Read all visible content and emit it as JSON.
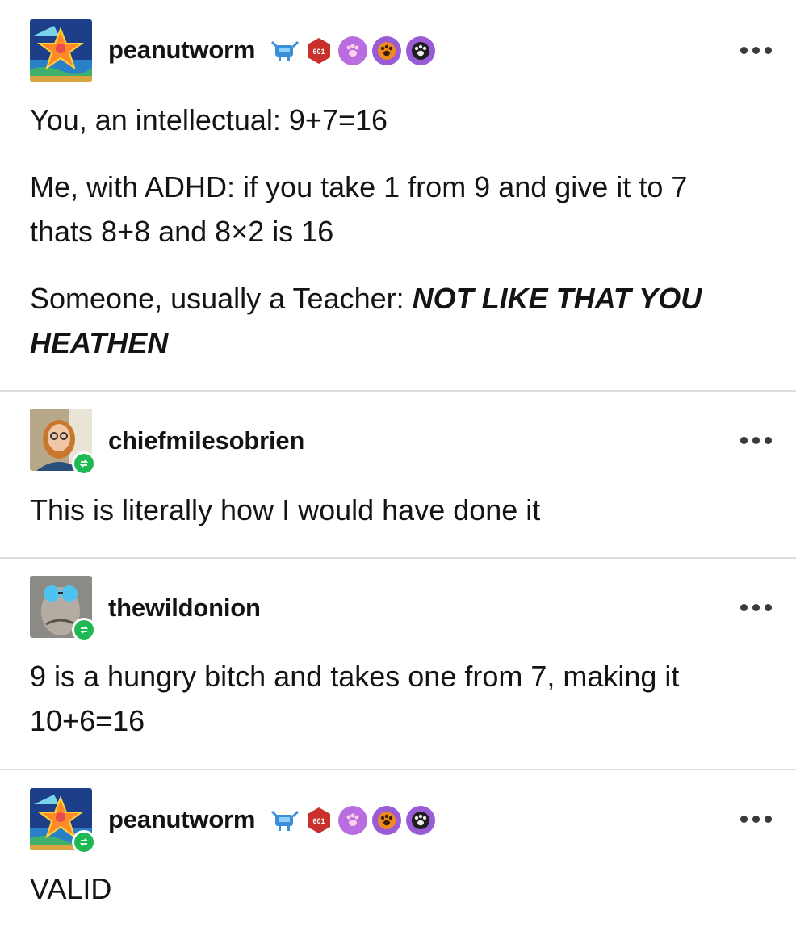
{
  "posts": [
    {
      "username": "peanutworm",
      "paragraphs": [
        "You, an intellectual: 9+7=16",
        "Me, with ADHD: if you take 1 from 9 and give it to 7 thats 8+8 and 8×2 is 16"
      ],
      "teacher_prefix": "Someone, usually a Teacher: ",
      "teacher_shout": "NOT LIKE THAT YOU HEATHEN"
    },
    {
      "username": "chiefmilesobrien",
      "paragraphs": [
        "This is literally how I would have done it"
      ]
    },
    {
      "username": "thewildonion",
      "paragraphs": [
        "9 is a hungry bitch and takes one from 7, making it 10+6=16"
      ]
    },
    {
      "username": "peanutworm",
      "paragraphs": [
        "VALID"
      ]
    }
  ],
  "badge_text": "601",
  "icons": {
    "more": "more-options-icon",
    "reblog": "reblog-icon"
  },
  "colors": {
    "reblog_green": "#1fb954",
    "divider": "#dcdcdc",
    "text": "#141414"
  }
}
